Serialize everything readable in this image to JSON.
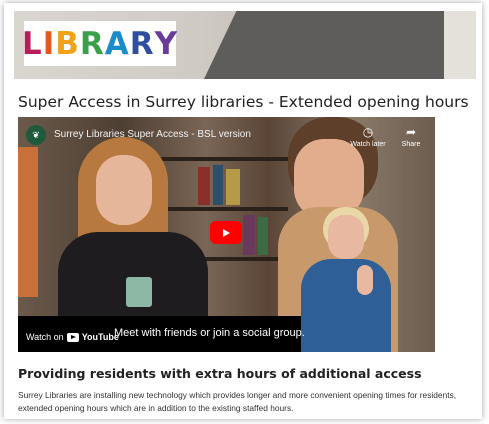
{
  "logo": {
    "letters": [
      {
        "char": "L",
        "color": "#b81f5a"
      },
      {
        "char": "I",
        "color": "#e35a1e"
      },
      {
        "char": "B",
        "color": "#f0a21a"
      },
      {
        "char": "R",
        "color": "#3aa04a"
      },
      {
        "char": "A",
        "color": "#1a8cc7"
      },
      {
        "char": "R",
        "color": "#2f4ea1"
      },
      {
        "char": "Y",
        "color": "#6a3b9a"
      }
    ]
  },
  "page": {
    "title": "Super Access in Surrey libraries - Extended opening hours",
    "section_heading": "Providing residents with extra hours of additional access",
    "paragraph": "Surrey Libraries are installing new technology which provides longer and more convenient opening times for residents, extended opening hours which are in addition to the existing staffed hours."
  },
  "video": {
    "channel_icon": "surrey-leaf-icon",
    "title": "Surrey Libraries Super Access - BSL version",
    "watch_later": "Watch later",
    "share": "Share",
    "caption": "Meet with friends or join a social group.",
    "watch_on": "Watch on",
    "youtube": "YouTube"
  }
}
